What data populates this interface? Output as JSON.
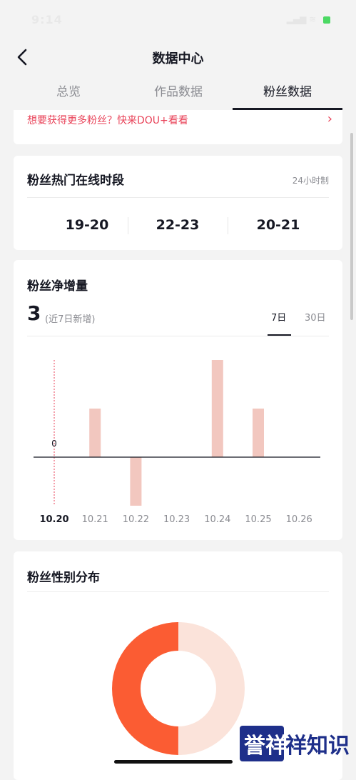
{
  "status_bar": {
    "time": "9:14",
    "signal": "▂▄▆ ≋"
  },
  "nav": {
    "title": "数据中心"
  },
  "tabs": [
    {
      "label": "总览"
    },
    {
      "label": "作品数据"
    },
    {
      "label": "粉丝数据"
    }
  ],
  "promo": {
    "text": "想要获得更多粉丝？快来DOU+看看",
    "chevron": "›"
  },
  "online": {
    "title": "粉丝热门在线时段",
    "unit": "24小时制",
    "slots": [
      "19-20",
      "22-23",
      "20-21"
    ]
  },
  "growth": {
    "title": "粉丝净增量",
    "value": "3",
    "note": "(近7日新增)",
    "range_tabs": [
      "7日",
      "30日"
    ],
    "active_range": "7日"
  },
  "chart_data": {
    "type": "bar",
    "categories": [
      "10.20",
      "10.21",
      "10.22",
      "10.23",
      "10.24",
      "10.25",
      "10.26"
    ],
    "values": [
      0,
      1,
      -1,
      0,
      2,
      1,
      0
    ],
    "selected_category": "10.20",
    "data_labels": [
      "0"
    ],
    "ylim": [
      -1,
      2
    ],
    "bar_color": "#f2c7bf",
    "axis_color": "#161823",
    "grid": false
  },
  "gender": {
    "title": "粉丝性别分布",
    "chart_data": {
      "type": "pie",
      "slices": [
        {
          "value": 0.5,
          "color": "#fbe3da"
        },
        {
          "value": 0.5,
          "color": "#fb5c33"
        }
      ]
    }
  },
  "watermark": {
    "text": "誉祥祥知识"
  },
  "colors": {
    "accent": "#e94359",
    "text": "#161823",
    "muted": "#8a8b91"
  }
}
